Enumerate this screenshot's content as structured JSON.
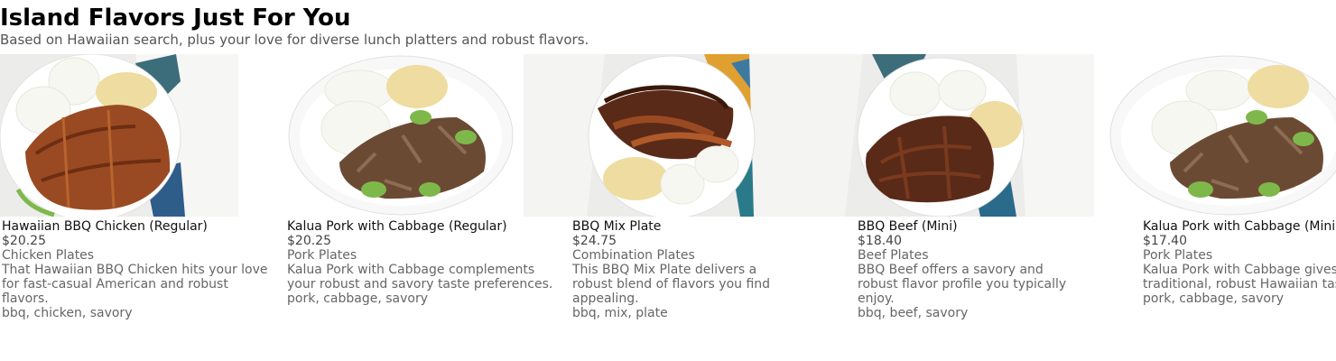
{
  "header": {
    "title": "Island Flavors Just For You",
    "subtitle": "Based on Hawaiian search, plus your love for diverse lunch platters and robust flavors."
  },
  "cards": [
    {
      "name": "Hawaiian BBQ Chicken (Regular)",
      "price": "$20.25",
      "category": "Chicken Plates",
      "description": "That Hawaiian BBQ Chicken hits your love for fast-casual American and robust flavors.",
      "tags": "bbq, chicken, savory"
    },
    {
      "name": "Kalua Pork with Cabbage (Regular)",
      "price": "$20.25",
      "category": "Pork Plates",
      "description": "Kalua Pork with Cabbage complements your robust and savory taste preferences.",
      "tags": "pork, cabbage, savory"
    },
    {
      "name": "BBQ Mix Plate",
      "price": "$24.75",
      "category": "Combination Plates",
      "description": "This BBQ Mix Plate delivers a robust blend of flavors you find appealing.",
      "tags": "bbq, mix, plate"
    },
    {
      "name": "BBQ Beef (Mini)",
      "price": "$18.40",
      "category": "Beef Plates",
      "description": "BBQ Beef offers a savory and robust flavor profile you typically enjoy.",
      "tags": "bbq, beef, savory"
    },
    {
      "name": "Kalua Pork with Cabbage (Mini)",
      "price": "$17.40",
      "category": "Pork Plates",
      "description": "Kalua Pork with Cabbage gives you a traditional, robust Hawaiian taste.",
      "tags": "pork, cabbage, savory"
    }
  ],
  "colors": {
    "rice": "#f7f7f2",
    "mac_salad": "#eedca0",
    "bbq_chicken": "#9a4a22",
    "kalua_pork": "#6b4a34",
    "cabbage": "#7fb84a",
    "bbq_beef": "#5a2a18",
    "plate": "#ffffff",
    "napkin": "#ececea"
  }
}
